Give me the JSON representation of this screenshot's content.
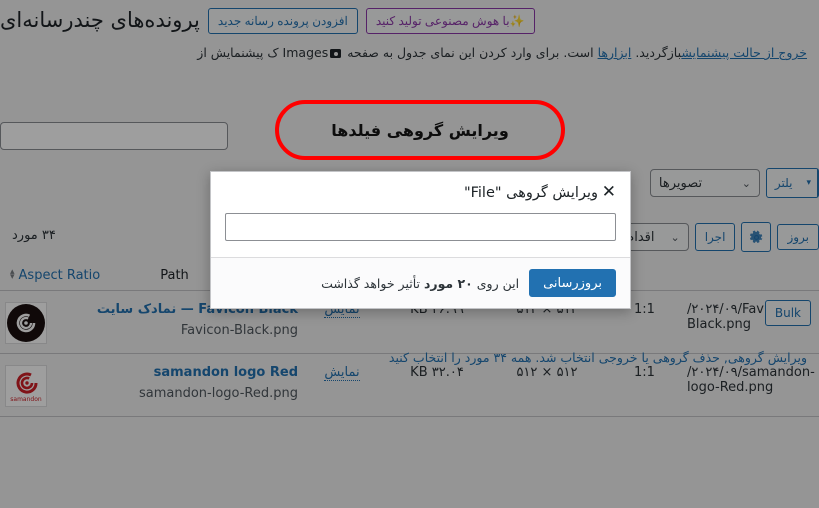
{
  "header": {
    "title": "پرونده‌های چندرسانه‌ای",
    "add_new_label": "افزودن پرونده رسانه جدید",
    "ai_generate_label": "✨با هوش مصنوعی تولید کنید"
  },
  "notice": {
    "before_link1": "ک پیشنمایش از",
    "images_word": "Images",
    "middle": "است. برای وارد کردن این نمای جدول به صفحه",
    "link_tools": "ابزارها",
    "after": "بازگردید.",
    "link_exit": "خروج از حالت پیشنمایش"
  },
  "callout": {
    "label": "ویرایش گروهی فیلدها",
    "border_color": "#ff0000"
  },
  "search": {
    "value": "",
    "placeholder": ""
  },
  "filters": {
    "filter_button_label": "یلتر",
    "type_select_value": "تصویرها",
    "chevron": "⌄",
    "split_arrow": "▾"
  },
  "bulk_toolbar": {
    "bulk_select_value": "اقدام دسته‌جمعی",
    "apply_label": "اجرا",
    "gear_icon": "gear-icon",
    "browse_label": "بروز"
  },
  "counts": {
    "items_count": "۳۴ مورد"
  },
  "table": {
    "columns": {
      "aspect_ratio": "Aspect Ratio",
      "path": "Path"
    },
    "rows": [
      {
        "title": "Favicon Black — نمادک سایت",
        "filename": "Favicon-Black.png",
        "view_label": "نمایش",
        "size": "۲۶.۹۹ KB",
        "dimensions": "۵۱۲ × ۵۱۲",
        "aspect_ratio": "1:1",
        "path": "/۲۰۲۴/۰۹/Favicon-Black.png",
        "thumb_color": "#1a1010"
      },
      {
        "title": "samandon logo Red",
        "filename": "samandon-logo-Red.png",
        "view_label": "نمایش",
        "size": "۳۲.۰۴ KB",
        "dimensions": "۵۱۲ × ۵۱۲",
        "aspect_ratio": "1:1",
        "path": "/۲۰۲۴/۰۹/samandon-logo-Red.png",
        "thumb_color": "#cf2027"
      }
    ],
    "bulk_button_label": "Bulk"
  },
  "selection_notice": {
    "text": "ویرایش گروهی, حذف گروهی یا خروجی انتخاب شد. همه ۳۴ مورد را انتخاب کنید",
    "prefix": "ویرایش گروهی, حذف گروهی یا خروجی انتخاب شد.",
    "link": "همه ۳۴ مورد را انتخاب کنید"
  },
  "modal": {
    "title": "ویرایش گروهی \"File\"",
    "close_icon": "✕",
    "input_value": "",
    "input_placeholder": "",
    "update_label": "بروزرسانی",
    "affect_prefix": "این روی ",
    "affect_count": "۲۰ مورد",
    "affect_suffix": " تأثیر خواهد گذاشت"
  },
  "colors": {
    "accent": "#2271b1",
    "ai_accent": "#8c37a8",
    "callout": "#ff0000",
    "page_bg": "#f0f0f1"
  }
}
